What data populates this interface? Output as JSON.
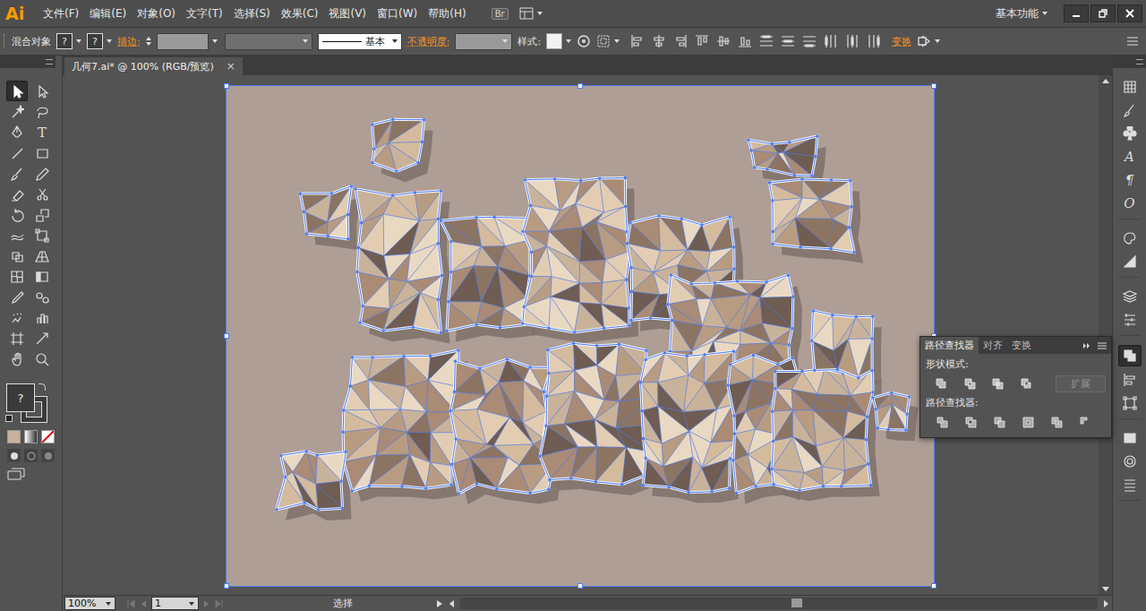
{
  "app": {
    "logo": "Ai"
  },
  "menus": [
    "文件(F)",
    "编辑(E)",
    "对象(O)",
    "文字(T)",
    "选择(S)",
    "效果(C)",
    "视图(V)",
    "窗口(W)",
    "帮助(H)"
  ],
  "bridge_button": "Br",
  "workspace": "基本功能",
  "control_bar": {
    "object_type": "混合对象",
    "fill": "?",
    "stroke": "?",
    "stroke_label": "描边:",
    "stroke_style": "基本",
    "opacity_label": "不透明度:",
    "style_label": "样式:",
    "transform_label": "变换"
  },
  "document_tab": {
    "title": "几何7.ai* @ 100% (RGB/预览)",
    "close": "×",
    "selected": true
  },
  "tools": [
    {
      "kind": "icon",
      "selected": true
    },
    {
      "kind": "icon",
      "selected": false
    },
    {
      "kind": "icon",
      "selected": false
    },
    {
      "kind": "icon",
      "selected": false
    },
    {
      "kind": "icon",
      "selected": false
    },
    {
      "kind": "glyph",
      "glyph": "T",
      "selected": false
    },
    {
      "kind": "icon",
      "selected": false
    },
    {
      "kind": "icon",
      "selected": false
    },
    {
      "kind": "icon",
      "selected": false
    },
    {
      "kind": "icon",
      "selected": false
    },
    {
      "kind": "icon",
      "selected": false
    },
    {
      "kind": "icon",
      "selected": false
    },
    {
      "kind": "icon",
      "selected": false
    },
    {
      "kind": "icon",
      "selected": false
    },
    {
      "kind": "icon",
      "selected": false
    },
    {
      "kind": "icon",
      "selected": false
    },
    {
      "kind": "icon",
      "selected": false
    },
    {
      "kind": "icon",
      "selected": false
    },
    {
      "kind": "icon",
      "selected": false
    },
    {
      "kind": "icon",
      "selected": false
    },
    {
      "kind": "icon",
      "selected": false
    },
    {
      "kind": "icon",
      "selected": false
    },
    {
      "kind": "icon",
      "selected": false
    },
    {
      "kind": "icon",
      "selected": false
    },
    {
      "kind": "icon",
      "selected": false
    },
    {
      "kind": "icon",
      "selected": false
    },
    {
      "kind": "icon",
      "selected": false
    },
    {
      "kind": "icon",
      "selected": false
    }
  ],
  "toolbar_fill": "?",
  "dock": [
    [
      {
        "kind": "icon",
        "selected": false
      },
      {
        "kind": "icon",
        "selected": false
      },
      {
        "kind": "icon",
        "selected": false
      },
      {
        "kind": "glyph",
        "glyph": "A",
        "selected": false
      },
      {
        "kind": "glyph",
        "glyph": "¶",
        "selected": false
      },
      {
        "kind": "glyph",
        "glyph": "O",
        "selected": false
      }
    ],
    [
      {
        "kind": "icon",
        "selected": false
      },
      {
        "kind": "icon",
        "selected": false
      }
    ],
    [
      {
        "kind": "icon",
        "selected": false
      },
      {
        "kind": "icon",
        "selected": false
      }
    ],
    [
      {
        "kind": "icon",
        "selected": true
      },
      {
        "kind": "icon",
        "selected": false
      },
      {
        "kind": "icon",
        "selected": false
      }
    ],
    [
      {
        "kind": "icon",
        "selected": false
      },
      {
        "kind": "icon",
        "selected": false
      },
      {
        "kind": "icon",
        "selected": false
      }
    ]
  ],
  "artboard": {
    "selected": true
  },
  "pathfinder_panel": {
    "tabs": [
      {
        "label": "路径查找器",
        "selected": true
      },
      {
        "label": "对齐",
        "selected": false
      },
      {
        "label": "变换",
        "selected": false
      }
    ],
    "shape_modes_label": "形状模式:",
    "shape_modes": [
      {
        "disabled": false
      },
      {
        "disabled": false
      },
      {
        "disabled": false
      },
      {
        "disabled": false
      }
    ],
    "expand": {
      "label": "扩展",
      "disabled": true
    },
    "pathfinders_label": "路径查找器:",
    "pathfinders": [
      {
        "disabled": false
      },
      {
        "disabled": false
      },
      {
        "disabled": false
      },
      {
        "disabled": false
      },
      {
        "disabled": false
      },
      {
        "disabled": false
      }
    ]
  },
  "status_bar": {
    "zoom": "100%",
    "page": "1",
    "tool": "选择"
  }
}
